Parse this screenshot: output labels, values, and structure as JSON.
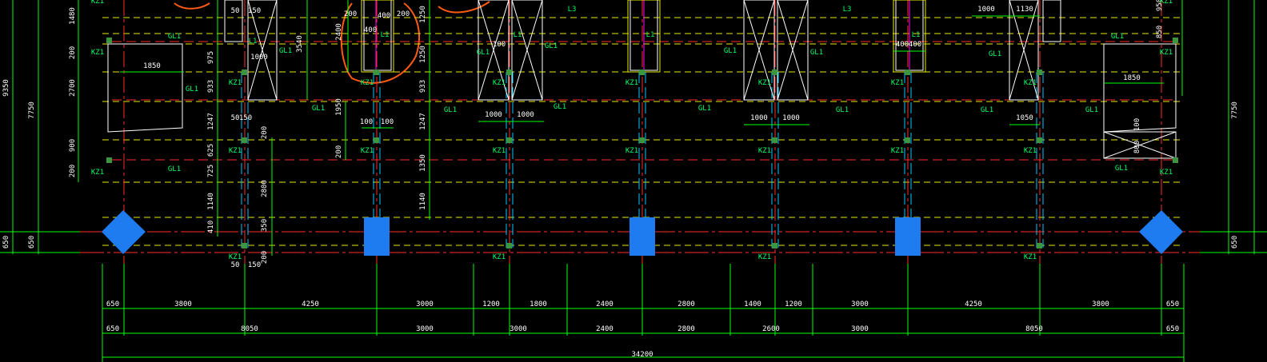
{
  "colors": {
    "background": "#000000",
    "axis_red": "#ff2a2a",
    "beam_yellow": "#e8e800",
    "dim_green": "#00ff00",
    "column_cyan": "#00c8ff",
    "pier_blue": "#1e7cf0",
    "window_white": "#ffffff",
    "annotation_orange": "#ff5a14",
    "magenta_line": "#ff00ff",
    "node_green": "#3c9640"
  },
  "labels": {
    "kz": "KZ1",
    "gl": "GL1",
    "l1": "L1",
    "l3": "L3"
  },
  "dimensions": {
    "row1": [
      "650",
      "3800",
      "4250",
      "3000",
      "1200",
      "1800",
      "2400",
      "2800",
      "1400",
      "1200",
      "3000",
      "4250",
      "3800",
      "650"
    ],
    "row2": [
      "650",
      "8050",
      "3000",
      "3000",
      "2400",
      "2800",
      "2600",
      "3000",
      "8050",
      "650"
    ],
    "total": "34200"
  },
  "left_vertical_dims": {
    "outer": [
      "9350"
    ],
    "second": [
      "7750"
    ],
    "bottom": [
      "650",
      "650"
    ],
    "inner": [
      "1480",
      "200",
      "2700",
      "900",
      "200"
    ],
    "inner2": [
      "975",
      "933",
      "1247",
      "625",
      "725",
      "1140",
      "410"
    ],
    "inner3": [
      "3540"
    ]
  },
  "right_vertical_dims": {
    "outer": [
      "7750"
    ],
    "bottom": [
      "650"
    ],
    "inner": [
      "950",
      "850"
    ]
  },
  "window_dims": {
    "w1850": "1850",
    "w1000": "1000",
    "w1050": "1050",
    "w1130": "1130",
    "w400": "400",
    "w100": "100",
    "w50": "50",
    "w150": "150",
    "w200": "200",
    "w2400": "2400",
    "w1250": "1250",
    "w1950": "1950",
    "w1350": "1350",
    "w2800": "2800",
    "w350": "350",
    "w1140": "1140",
    "w800": "800"
  }
}
